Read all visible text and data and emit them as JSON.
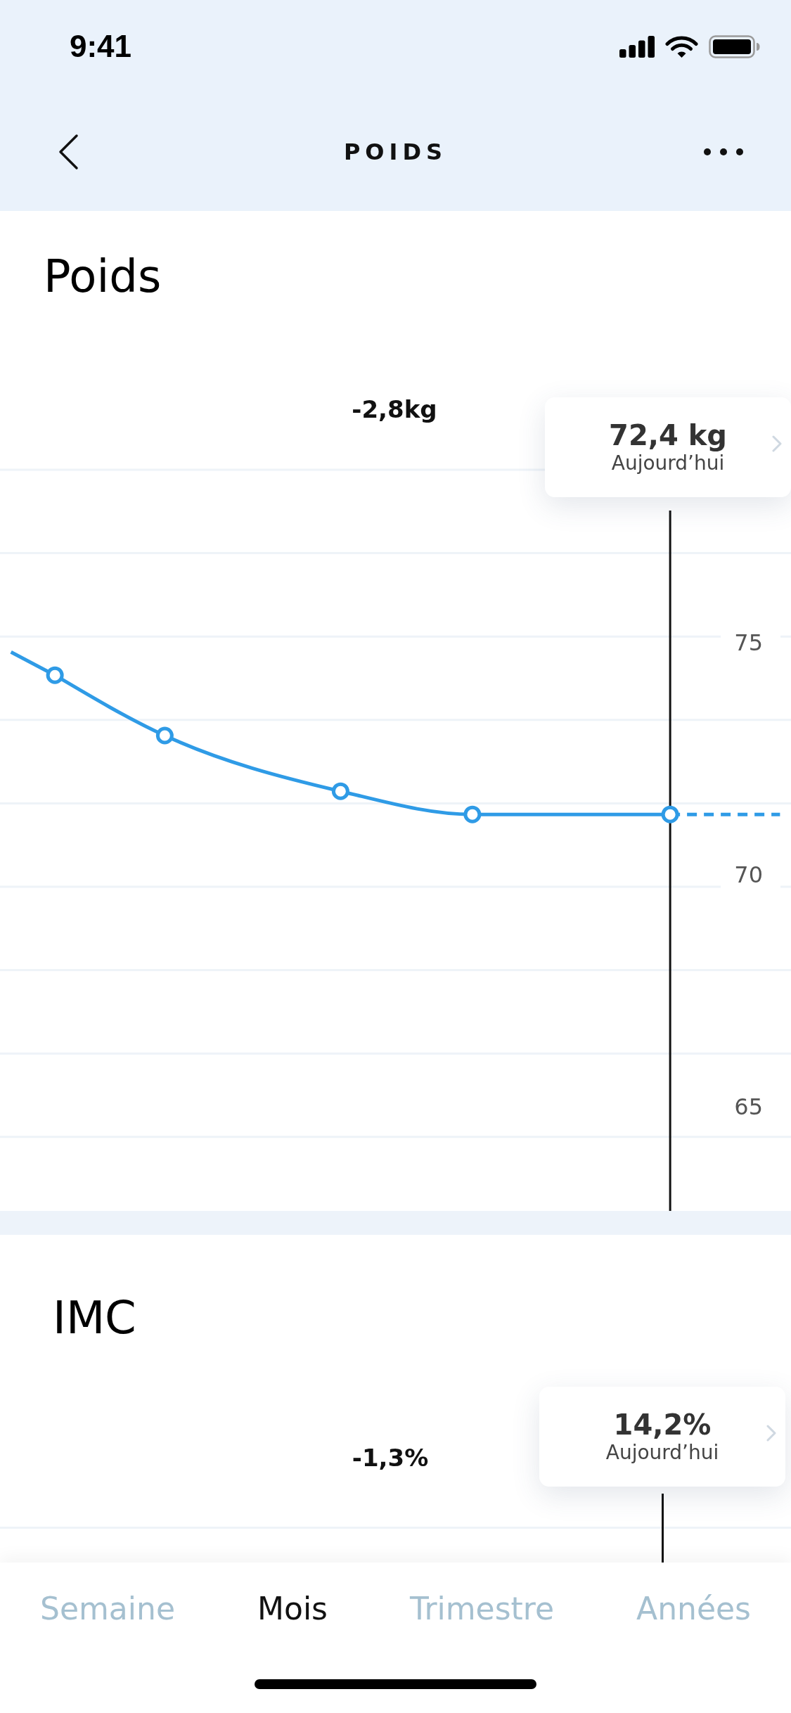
{
  "status_bar": {
    "time": "9:41"
  },
  "nav_bar": {
    "title": "POIDS"
  },
  "weight_section": {
    "title": "Poids",
    "change": "-2,8kg",
    "tooltip": {
      "value": "72,4 kg",
      "caption": "Aujourd’hui"
    },
    "chart_data": {
      "type": "line",
      "categories": [
        null,
        null,
        null,
        null,
        null,
        null,
        null,
        null,
        null,
        null,
        null,
        null,
        null,
        null,
        null,
        null,
        null,
        null,
        null,
        null,
        null,
        null,
        null,
        null,
        null,
        null,
        null,
        null,
        null,
        null,
        null,
        null,
        null,
        null,
        null,
        null
      ],
      "ylim": [
        65,
        75
      ],
      "yticks": [
        {
          "value": 65,
          "label": "65"
        },
        {
          "value": 70,
          "label": "70"
        },
        {
          "value": 75,
          "label": "75"
        }
      ],
      "series": [
        {
          "color": "#2f9be6",
          "marker": "o",
          "values": [
            null,
            null,
            74.3,
            null,
            null,
            null,
            null,
            73.0,
            null,
            null,
            null,
            null,
            null,
            null,
            null,
            71.8,
            null,
            null,
            null,
            null,
            null,
            71.3,
            null,
            null,
            null,
            null,
            null,
            null,
            null,
            null,
            71.3,
            null,
            null,
            null,
            null,
            null
          ]
        },
        {
          "color": "#2f9be6",
          "values": [
            74.8,
            null,
            74.3,
            null,
            null,
            null,
            null,
            null,
            null,
            null,
            null,
            null,
            null,
            null,
            null,
            null,
            null,
            null,
            null,
            null,
            null,
            null,
            null,
            null,
            null,
            null,
            null,
            null,
            null,
            null,
            null,
            null,
            null,
            null,
            null,
            null
          ]
        },
        {
          "color": "#2f9be6",
          "line_style": "dashed",
          "values": [
            null,
            null,
            null,
            null,
            null,
            null,
            null,
            null,
            null,
            null,
            null,
            null,
            null,
            null,
            null,
            null,
            null,
            null,
            null,
            null,
            null,
            null,
            null,
            null,
            null,
            null,
            null,
            null,
            null,
            null,
            71.3,
            null,
            null,
            null,
            null,
            71.3
          ]
        }
      ]
    }
  },
  "bmi_section": {
    "title": "IMC",
    "change": "-1,3%",
    "tooltip": {
      "value": "14,2%",
      "caption": "Aujourd’hui"
    }
  },
  "tabs": [
    {
      "label": "Semaine",
      "selected": false
    },
    {
      "label": "Mois",
      "selected": true
    },
    {
      "label": "Trimestre",
      "selected": false
    },
    {
      "label": "Années",
      "selected": false
    }
  ]
}
